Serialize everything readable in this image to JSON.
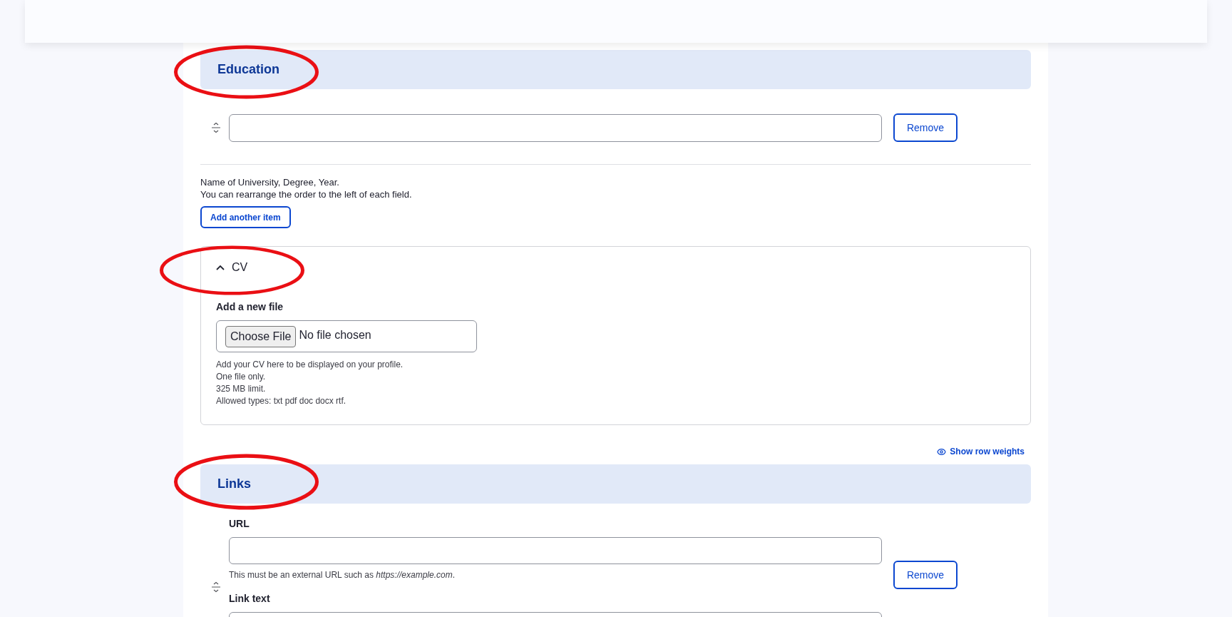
{
  "education": {
    "title": "Education",
    "rows": [
      {
        "remove": "Remove"
      }
    ],
    "help": [
      "Name of University, Degree, Year.",
      "You can rearrange the order to the left of each field."
    ],
    "add_button": "Add another item"
  },
  "cv": {
    "title": "CV",
    "expanded": true,
    "label": "Add a new file",
    "file_button": "Choose File",
    "file_status": "No file chosen",
    "help": [
      "Add your CV here to be displayed on your profile.",
      "One file only.",
      "325 MB limit.",
      "Allowed types: txt pdf doc docx rtf."
    ]
  },
  "show_row_weights": "Show row weights",
  "links": {
    "title": "Links",
    "rows": [
      {
        "url_label": "URL",
        "url_help": "This must be an external URL such as *https://example.com*.",
        "link_text_label": "Link text",
        "remove": "Remove"
      }
    ]
  }
}
